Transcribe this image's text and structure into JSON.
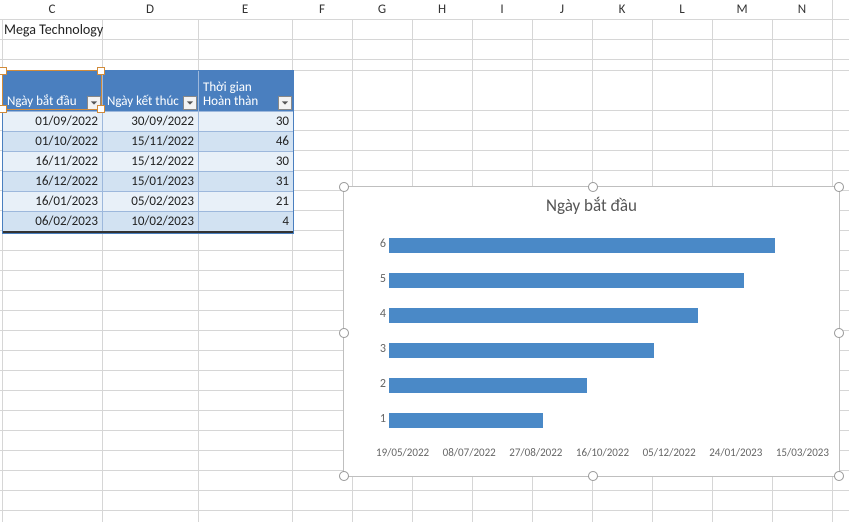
{
  "columns": [
    "C",
    "D",
    "E",
    "F",
    "G",
    "H",
    "I",
    "J",
    "K",
    "L",
    "M",
    "N"
  ],
  "title": "Mega Technology",
  "table": {
    "headers": [
      "Ngày bắt đầu",
      "Ngày kết thúc",
      "Thời gian Hoàn thàn"
    ],
    "rows": [
      {
        "start": "01/09/2022",
        "end": "30/09/2022",
        "dur": "30"
      },
      {
        "start": "01/10/2022",
        "end": "15/11/2022",
        "dur": "46"
      },
      {
        "start": "16/11/2022",
        "end": "15/12/2022",
        "dur": "30"
      },
      {
        "start": "16/12/2022",
        "end": "15/01/2023",
        "dur": "31"
      },
      {
        "start": "16/01/2023",
        "end": "05/02/2023",
        "dur": "21"
      },
      {
        "start": "06/02/2023",
        "end": "10/02/2023",
        "dur": "4"
      }
    ]
  },
  "chart_data": {
    "type": "bar",
    "orientation": "horizontal",
    "title": "Ngày bắt đầu",
    "categories": [
      "1",
      "2",
      "3",
      "4",
      "5",
      "6"
    ],
    "x_ticks": [
      "19/05/2022",
      "08/07/2022",
      "27/08/2022",
      "16/10/2022",
      "05/12/2022",
      "24/01/2023",
      "15/03/2023"
    ],
    "x_min_serial": 44700,
    "x_max_serial": 45000,
    "series": [
      {
        "name": "Ngày bắt đầu",
        "values_dates": [
          "01/09/2022",
          "01/10/2022",
          "16/11/2022",
          "16/12/2022",
          "16/01/2023",
          "06/02/2023"
        ],
        "serial": [
          44805,
          44835,
          44881,
          44911,
          44942,
          44963
        ]
      }
    ],
    "note": "Each horizontal bar starts at x_min and ends at the serial date value of Ngày bắt đầu for that row. Category 1 is the first table row, category 6 the last; y-axis is drawn inverted (6 at top)."
  }
}
